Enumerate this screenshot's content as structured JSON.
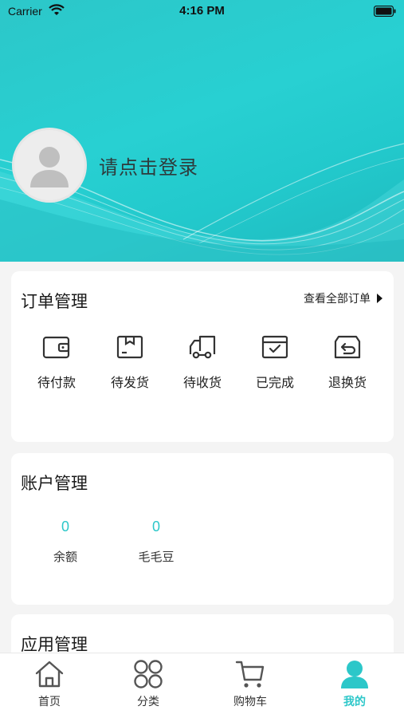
{
  "status_bar": {
    "carrier": "Carrier",
    "time": "4:16 PM"
  },
  "profile": {
    "login_prompt": "请点击登录"
  },
  "orders": {
    "title": "订单管理",
    "view_all": "查看全部订单",
    "items": [
      {
        "label": "待付款",
        "icon": "wallet-icon"
      },
      {
        "label": "待发货",
        "icon": "package-icon"
      },
      {
        "label": "待收货",
        "icon": "truck-icon"
      },
      {
        "label": "已完成",
        "icon": "completed-icon"
      },
      {
        "label": "退换货",
        "icon": "return-icon"
      }
    ]
  },
  "account": {
    "title": "账户管理",
    "items": [
      {
        "value": "0",
        "label": "余额"
      },
      {
        "value": "0",
        "label": "毛毛豆"
      }
    ]
  },
  "apps": {
    "title": "应用管理"
  },
  "tabbar": {
    "active_color": "#2cc7c9",
    "items": [
      {
        "label": "首页",
        "icon": "home-icon"
      },
      {
        "label": "分类",
        "icon": "category-icon"
      },
      {
        "label": "购物车",
        "icon": "cart-icon"
      },
      {
        "label": "我的",
        "icon": "profile-icon",
        "active": true
      }
    ]
  }
}
